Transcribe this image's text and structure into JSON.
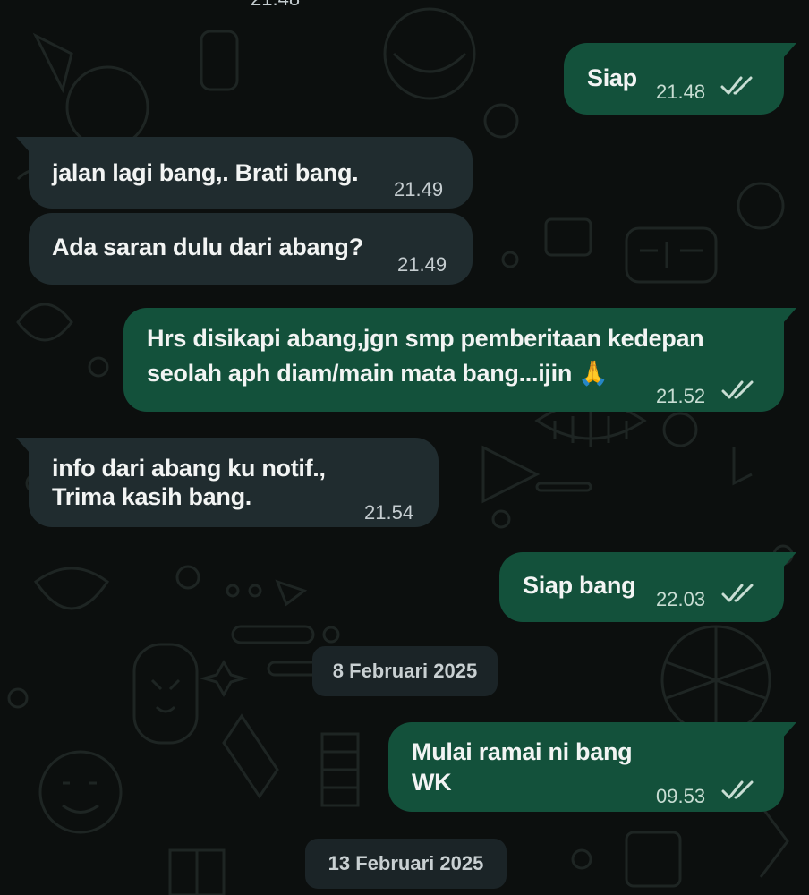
{
  "messages": [
    {
      "direction": "outgoing",
      "text": "Siap",
      "time": "21.48",
      "status": "read"
    },
    {
      "direction": "incoming",
      "text": "jalan lagi bang,. Brati bang.",
      "time": "21.49"
    },
    {
      "direction": "incoming",
      "text": "Ada saran dulu dari abang?",
      "time": "21.49"
    },
    {
      "direction": "outgoing",
      "lines": [
        "Hrs disikapi abang,jgn smp pemberitaan kedepan",
        "seolah aph diam/main mata bang...ijin 🙏"
      ],
      "time": "21.52",
      "status": "read"
    },
    {
      "direction": "incoming",
      "lines": [
        "info dari abang ku notif.,",
        "Trima kasih bang."
      ],
      "time": "21.54"
    },
    {
      "direction": "outgoing",
      "text": "Siap bang",
      "time": "22.03",
      "status": "read"
    },
    {
      "direction": "outgoing",
      "lines": [
        "Mulai ramai ni bang",
        "WK"
      ],
      "time": "09.53",
      "status": "read"
    }
  ],
  "dates": [
    "8 Februari 2025",
    "13 Februari 2025"
  ],
  "colors": {
    "background": "#0c0f0e",
    "incoming_bubble": "#202c2f",
    "outgoing_bubble": "#13513b",
    "read_ticks": "#c8ddd3",
    "date_pill": "#1b2427"
  },
  "icons": {
    "read_status": "double-check-icon",
    "emoji": "folded-hands-emoji"
  }
}
